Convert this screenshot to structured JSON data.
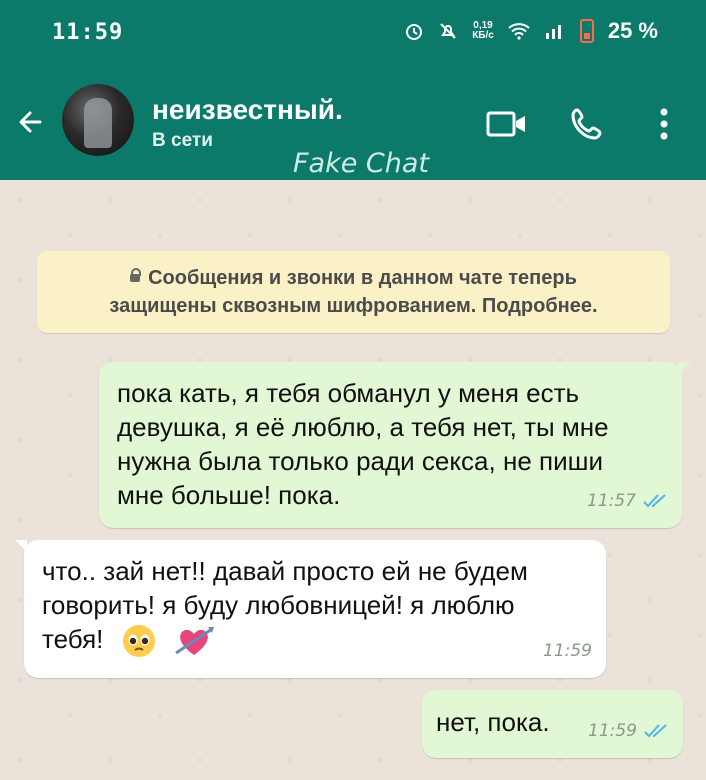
{
  "status_bar": {
    "time": "11:59",
    "net_speed_top": "0,19",
    "net_speed_bottom": "КБ/с",
    "battery_percent": "25 %",
    "icons": [
      "alarm-icon",
      "mute-icon",
      "wifi-icon",
      "signal-icon",
      "battery-icon"
    ]
  },
  "header": {
    "contact_name": "неизвестный.",
    "contact_status": "В сети",
    "watermark": "Fake Chat",
    "actions": [
      "video-call-icon",
      "voice-call-icon",
      "more-vertical-icon"
    ]
  },
  "chat": {
    "system_notice_line1": "Сообщения и звонки в данном чате теперь",
    "system_notice_line2": "защищены сквозным шифрованием. Подробнее.",
    "messages": [
      {
        "direction": "outgoing",
        "lines": [
          "пока кать, я тебя обманул у меня есть",
          "девушка, я её люблю, а тебя нет, ты мне",
          "нужна была только ради секса, не пиши",
          "мне больше! пока."
        ],
        "time": "11:57",
        "read": true
      },
      {
        "direction": "incoming",
        "lines": [
          "что.. зай нет!! давай просто ей не будем",
          "говорить! я буду любовницей! я люблю",
          "тебя!"
        ],
        "emojis": [
          "pleading-face",
          "heart-with-arrow"
        ],
        "time": "11:59"
      },
      {
        "direction": "outgoing",
        "lines": [
          "нет, пока."
        ],
        "time": "11:59",
        "read": true
      }
    ]
  },
  "colors": {
    "header": "#0b7a6b",
    "outgoing_bubble": "#e2f8d4",
    "incoming_bubble": "#ffffff",
    "system_bubble": "#fbf1c6",
    "read_ticks": "#4fb6ec"
  }
}
